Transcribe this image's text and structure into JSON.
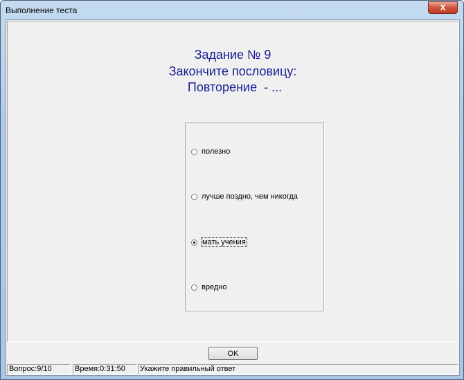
{
  "window": {
    "title": "Выполнение теста",
    "close_label": "X"
  },
  "question": {
    "line1": "Задание № 9",
    "line2": "Закончите пословицу:",
    "line3": "Повторение  - ..."
  },
  "options": [
    {
      "label": "полезно",
      "selected": false
    },
    {
      "label": "лучше поздно, чем никогда",
      "selected": false
    },
    {
      "label": "мать учения",
      "selected": true
    },
    {
      "label": "вредно",
      "selected": false
    }
  ],
  "ok_label": "OK",
  "status": {
    "question": "Вопрос:9/10",
    "time": "Время:0:31:50",
    "hint": "Укажите правильный ответ"
  }
}
